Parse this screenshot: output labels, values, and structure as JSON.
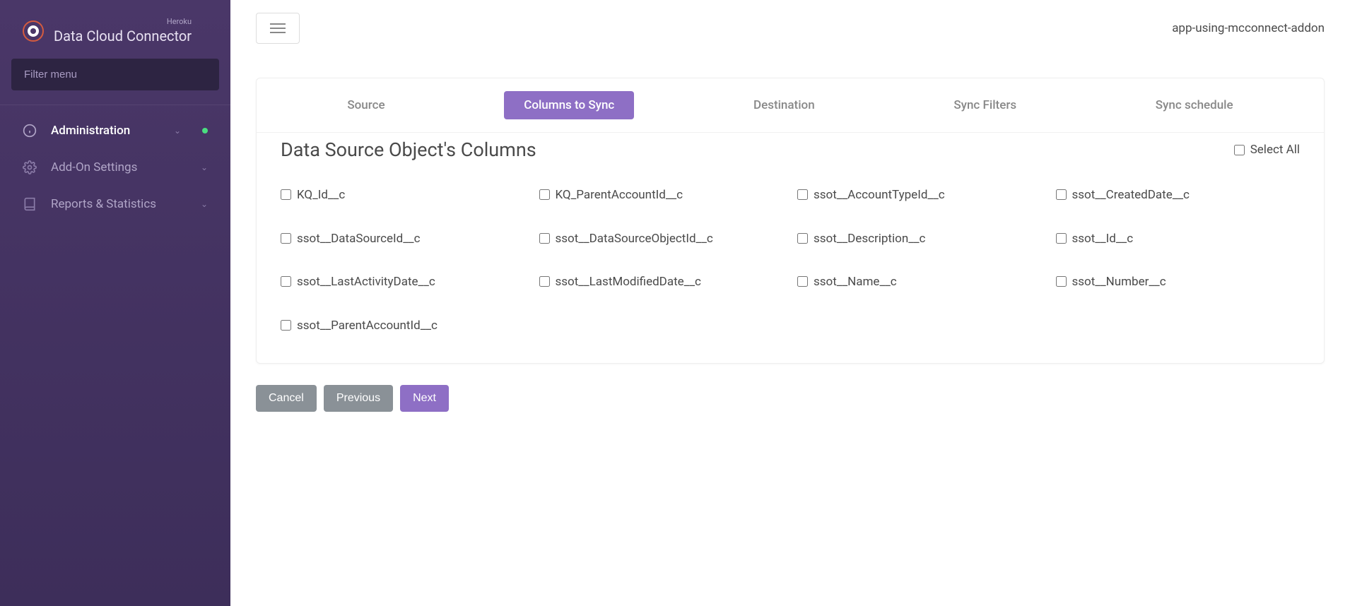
{
  "sidebar": {
    "subtitle": "Heroku",
    "title": "Data Cloud Connector",
    "filter_placeholder": "Filter menu",
    "items": [
      {
        "label": "Administration",
        "active": true,
        "status": true
      },
      {
        "label": "Add-On Settings",
        "active": false,
        "status": false
      },
      {
        "label": "Reports & Statistics",
        "active": false,
        "status": false
      }
    ]
  },
  "topbar": {
    "app_name": "app-using-mcconnect-addon"
  },
  "tabs": {
    "items": [
      {
        "label": "Source",
        "active": false
      },
      {
        "label": "Columns to Sync",
        "active": true
      },
      {
        "label": "Destination",
        "active": false
      },
      {
        "label": "Sync Filters",
        "active": false
      },
      {
        "label": "Sync schedule",
        "active": false
      }
    ]
  },
  "section": {
    "title": "Data Source Object's Columns",
    "select_all_label": "Select All"
  },
  "columns": [
    "KQ_Id__c",
    "KQ_ParentAccountId__c",
    "ssot__AccountTypeId__c",
    "ssot__CreatedDate__c",
    "ssot__DataSourceId__c",
    "ssot__DataSourceObjectId__c",
    "ssot__Description__c",
    "ssot__Id__c",
    "ssot__LastActivityDate__c",
    "ssot__LastModifiedDate__c",
    "ssot__Name__c",
    "ssot__Number__c",
    "ssot__ParentAccountId__c"
  ],
  "buttons": {
    "cancel": "Cancel",
    "previous": "Previous",
    "next": "Next"
  }
}
